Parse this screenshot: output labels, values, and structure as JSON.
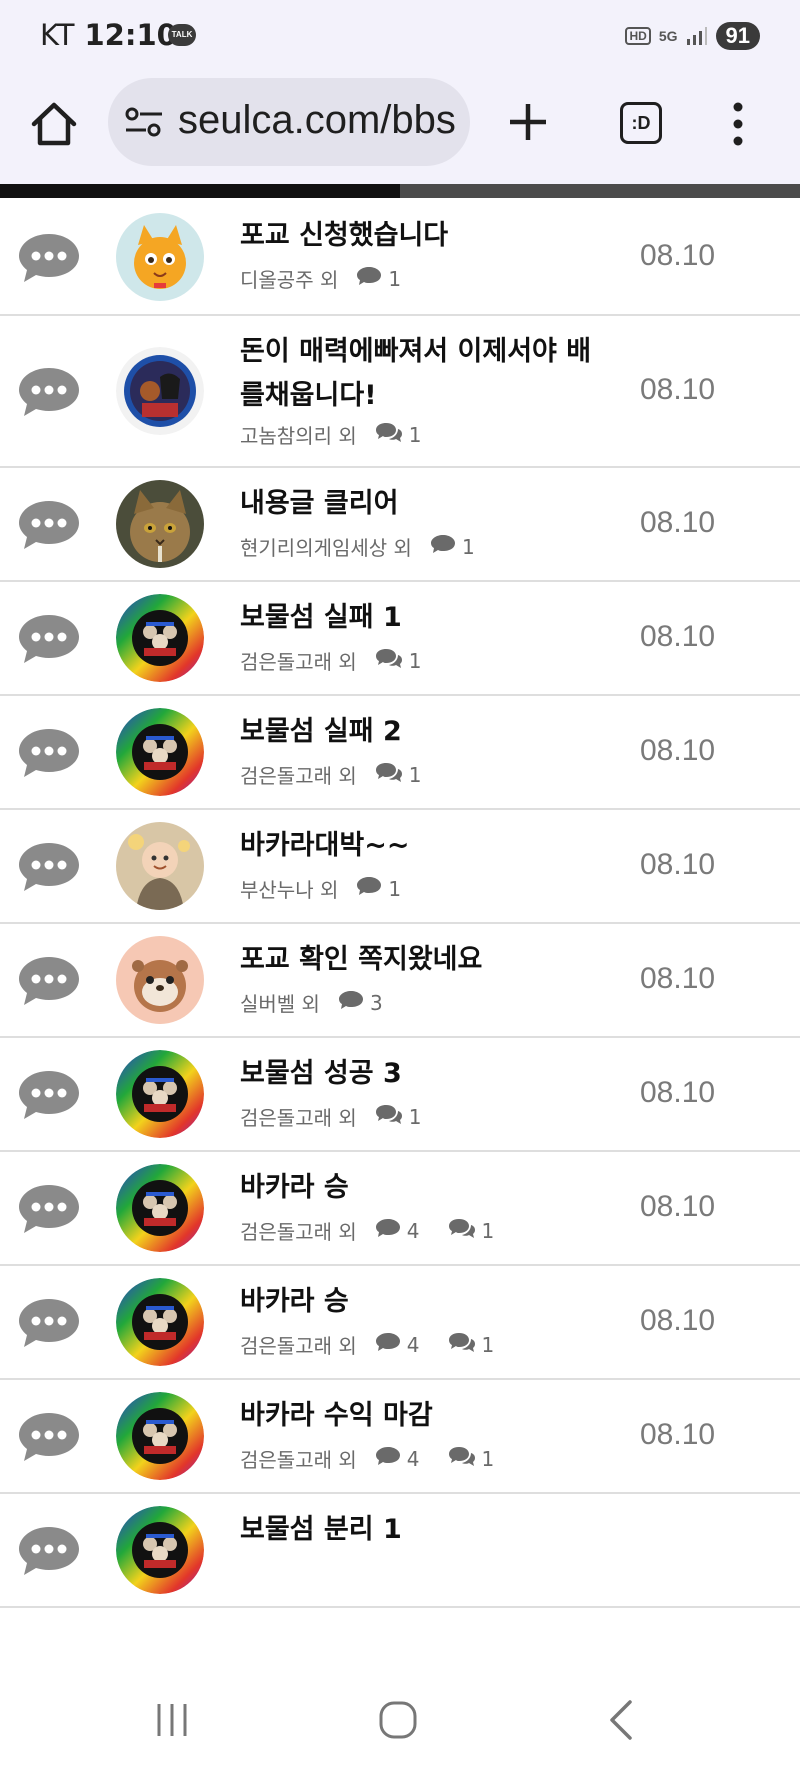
{
  "status_bar": {
    "carrier": "KT",
    "time": "12:10",
    "talk_badge": "TALK",
    "hd_label": "HD",
    "network_label": "5G",
    "battery": "91"
  },
  "browser": {
    "url": "seulca.com/bbs",
    "tab_switch_label": ":D",
    "page_load_progress": 0.5
  },
  "posts": [
    {
      "title": "포교 신청했습니다",
      "author": "디올공주 외",
      "comments": "1",
      "replies": "",
      "date": "08.10",
      "avatar": "cartoon-cat"
    },
    {
      "title": "돈이 매력에빠져서 이제서야 배를채웁니다!",
      "author": "고놈참의리 외",
      "comments": "",
      "replies": "1",
      "date": "08.10",
      "avatar": "photo-couple"
    },
    {
      "title": "내용글 클리어",
      "author": "현기리의게임세상 외",
      "comments": "1",
      "replies": "",
      "date": "08.10",
      "avatar": "cat-photo"
    },
    {
      "title": "보물섬 실패 1",
      "author": "검은돌고래 외",
      "comments": "",
      "replies": "1",
      "date": "08.10",
      "avatar": "rainbow-ring"
    },
    {
      "title": "보물섬 실패 2",
      "author": "검은돌고래 외",
      "comments": "",
      "replies": "1",
      "date": "08.10",
      "avatar": "rainbow-ring"
    },
    {
      "title": "바카라대박~~",
      "author": "부산누나 외",
      "comments": "1",
      "replies": "",
      "date": "08.10",
      "avatar": "monk-doll"
    },
    {
      "title": "포교 확인 쪽지왔네요",
      "author": "실버벨 외",
      "comments": "3",
      "replies": "",
      "date": "08.10",
      "avatar": "otter"
    },
    {
      "title": "보물섬 성공 3",
      "author": "검은돌고래 외",
      "comments": "",
      "replies": "1",
      "date": "08.10",
      "avatar": "rainbow-ring"
    },
    {
      "title": "바카라 승",
      "author": "검은돌고래 외",
      "comments": "4",
      "replies": "1",
      "date": "08.10",
      "avatar": "rainbow-ring"
    },
    {
      "title": "바카라 승",
      "author": "검은돌고래 외",
      "comments": "4",
      "replies": "1",
      "date": "08.10",
      "avatar": "rainbow-ring"
    },
    {
      "title": "바카라 수익 마감",
      "author": "검은돌고래 외",
      "comments": "4",
      "replies": "1",
      "date": "08.10",
      "avatar": "rainbow-ring"
    },
    {
      "title": "보물섬 분리 1",
      "author": "",
      "comments": "",
      "replies": "",
      "date": "",
      "avatar": "rainbow-ring"
    }
  ],
  "colors": {
    "chrome_bg": "#f3f2fb",
    "urlbar_bg": "#e3e2ec",
    "bubble_icon": "#8a8a8a",
    "divider": "#dedede"
  }
}
